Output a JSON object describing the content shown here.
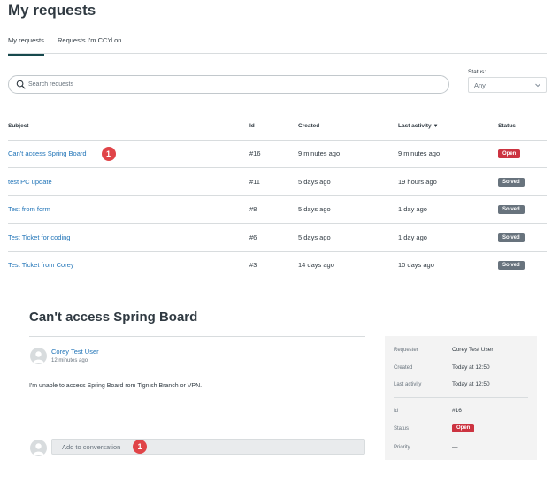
{
  "page": {
    "title": "My requests"
  },
  "tabs": [
    {
      "label": "My requests",
      "active": true
    },
    {
      "label": "Requests I'm CC'd on",
      "active": false
    }
  ],
  "search": {
    "placeholder": "Search requests",
    "value": "",
    "icon": "search-icon"
  },
  "status_filter": {
    "label": "Status:",
    "selected": "Any",
    "icon": "chevron-down-icon"
  },
  "table": {
    "headers": {
      "subject": "Subject",
      "id": "Id",
      "created": "Created",
      "last_activity": "Last activity",
      "last_activity_sort": "▼",
      "status": "Status"
    },
    "rows": [
      {
        "subject": "Can't access Spring Board",
        "id": "#16",
        "created": "9 minutes ago",
        "last_activity": "9 minutes ago",
        "status": "Open",
        "marker": "1"
      },
      {
        "subject": "test PC update",
        "id": "#11",
        "created": "5 days ago",
        "last_activity": "19 hours ago",
        "status": "Solved"
      },
      {
        "subject": "Test from form",
        "id": "#8",
        "created": "5 days ago",
        "last_activity": "1 day ago",
        "status": "Solved"
      },
      {
        "subject": "Test Ticket for coding",
        "id": "#6",
        "created": "5 days ago",
        "last_activity": "1 day ago",
        "status": "Solved"
      },
      {
        "subject": "Test Ticket from Corey",
        "id": "#3",
        "created": "14 days ago",
        "last_activity": "10 days ago",
        "status": "Solved"
      }
    ]
  },
  "detail": {
    "title": "Can't access Spring Board",
    "comment": {
      "author": "Corey Test User",
      "time": "12 minutes ago",
      "body": "I'm unable to access Spring Board rom Tignish Branch or VPN."
    },
    "reply": {
      "placeholder": "Add to conversation",
      "marker": "1"
    },
    "sidebar": {
      "requester_label": "Requester",
      "requester": "Corey Test User",
      "created_label": "Created",
      "created": "Today at 12:50",
      "last_activity_label": "Last activity",
      "last_activity": "Today at 12:50",
      "id_label": "Id",
      "id": "#16",
      "status_label": "Status",
      "status": "Open",
      "priority_label": "Priority",
      "priority": "—"
    }
  },
  "colors": {
    "link": "#1f73b7",
    "open_badge": "#cc3340",
    "solved_badge": "#68737d",
    "marker": "#e04448",
    "tab_underline": "#17494d"
  }
}
